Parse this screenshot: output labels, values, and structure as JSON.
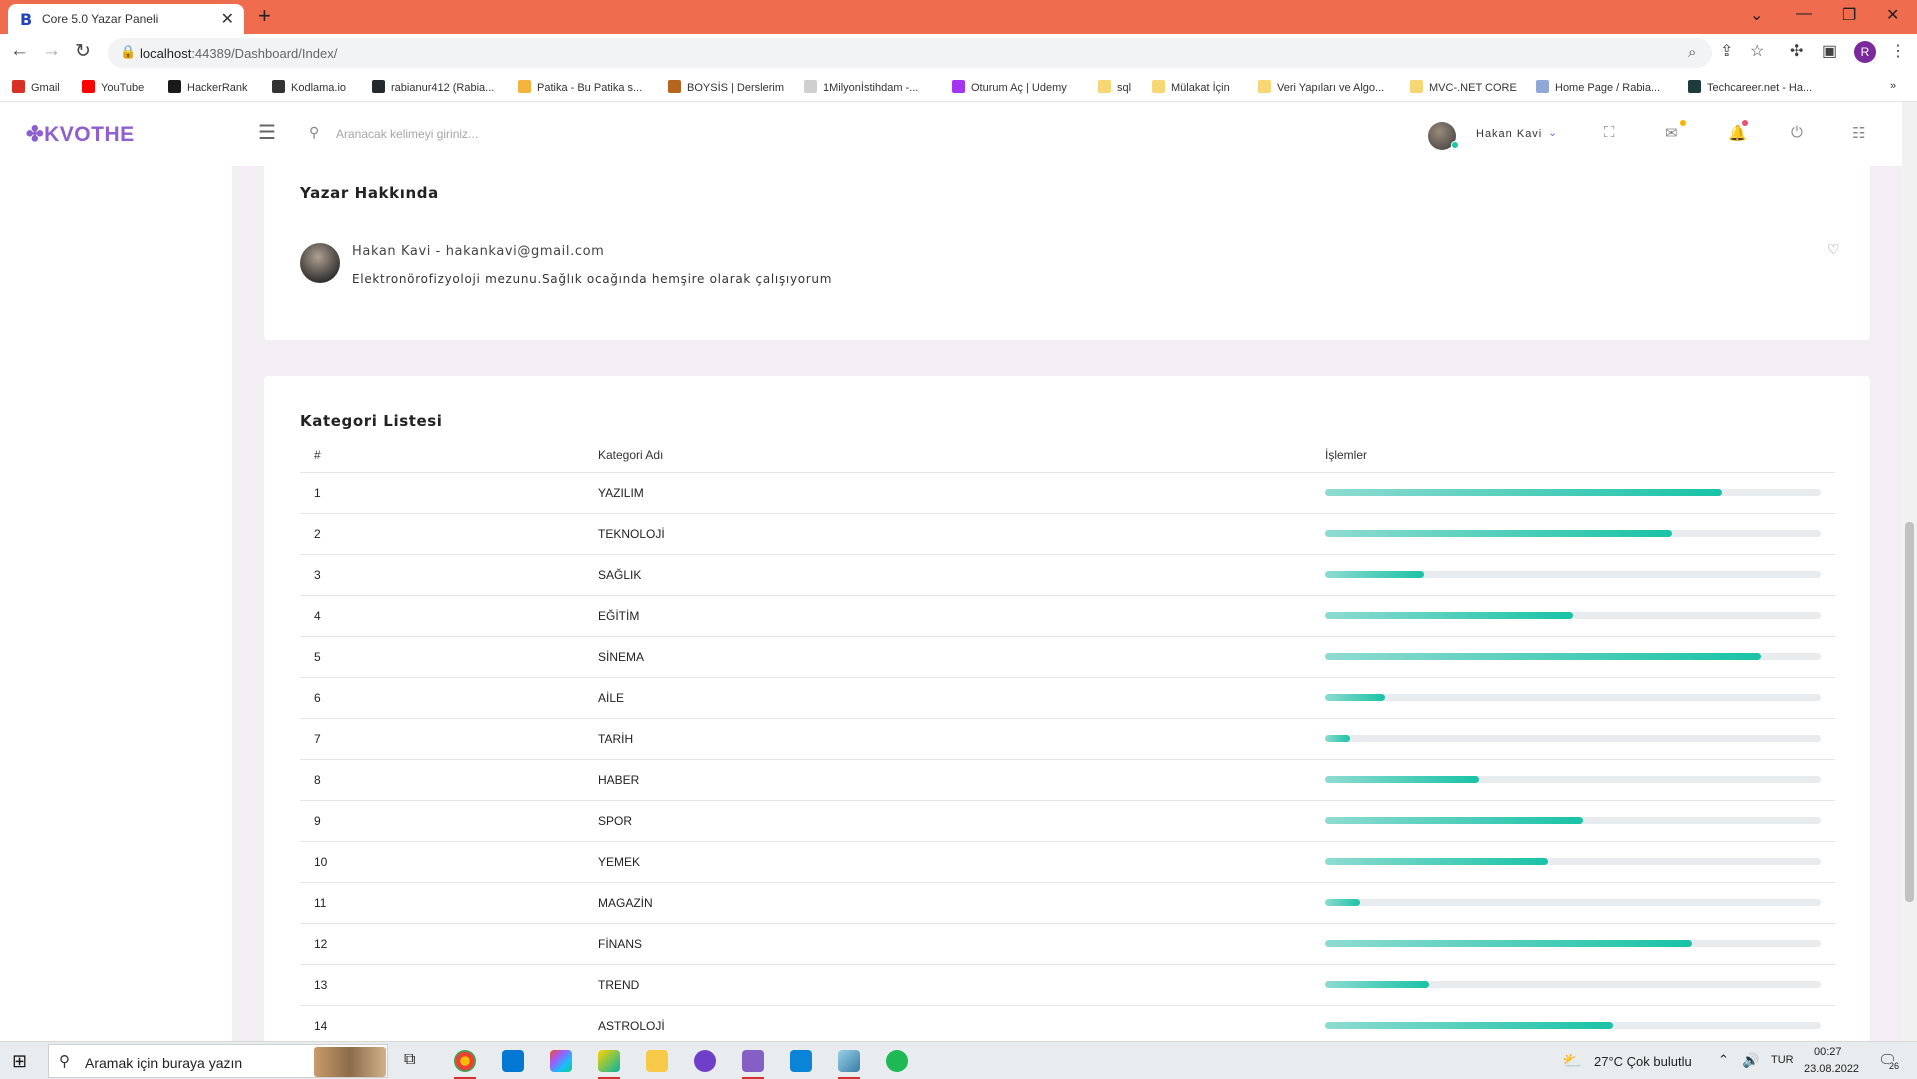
{
  "browser": {
    "tab_title": "Core 5.0 Yazar Paneli",
    "tab_favicon": "B",
    "url_host": "localhost",
    "url_rest": ":44389/Dashboard/Index/",
    "profile_initial": "R",
    "bookmarks": [
      {
        "label": "Gmail",
        "color": "#d93025"
      },
      {
        "label": "YouTube",
        "color": "#ff0000"
      },
      {
        "label": "HackerRank",
        "color": "#1a1a1a"
      },
      {
        "label": "Kodlama.io",
        "color": "#333333"
      },
      {
        "label": "rabianur412 (Rabia...",
        "color": "#24292e"
      },
      {
        "label": "Patika - Bu Patika s...",
        "color": "#f3b43e"
      },
      {
        "label": "BOYSİS | Derslerim",
        "color": "#b5651d"
      },
      {
        "label": "1Milyonİstihdam -...",
        "color": "#cfcfcf"
      },
      {
        "label": "Oturum Aç | Udemy",
        "color": "#a435f0"
      },
      {
        "label": "sql",
        "color": "#f7d774"
      },
      {
        "label": "Mülakat İçin",
        "color": "#f7d774"
      },
      {
        "label": "Veri Yapıları ve Algo...",
        "color": "#f7d774"
      },
      {
        "label": "MVC-.NET CORE",
        "color": "#f7d774"
      },
      {
        "label": "Home Page / Rabia...",
        "color": "#8fa8d8"
      },
      {
        "label": "Techcareer.net - Ha...",
        "color": "#1d3b3b"
      }
    ]
  },
  "topnav": {
    "logo": "KVOTHE",
    "search_placeholder": "Aranacak kelimeyi giriniz...",
    "username": "Hakan Kavi"
  },
  "about": {
    "title": "Yazar Hakkında",
    "name_email": "Hakan Kavi - hakankavi@gmail.com",
    "bio": "Elektronörofizyoloji mezunu.Sağlık ocağında hemşire olarak çalışıyorum"
  },
  "categories": {
    "title": "Kategori Listesi",
    "headers": [
      "#",
      "Kategori Adı",
      "İşlemler"
    ],
    "rows": [
      {
        "no": "1",
        "name": "YAZILIM",
        "progress": 80
      },
      {
        "no": "2",
        "name": "TEKNOLOJİ",
        "progress": 70
      },
      {
        "no": "3",
        "name": "SAĞLIK",
        "progress": 20
      },
      {
        "no": "4",
        "name": "EĞİTİM",
        "progress": 50
      },
      {
        "no": "5",
        "name": "SİNEMA",
        "progress": 88
      },
      {
        "no": "6",
        "name": "AİLE",
        "progress": 12
      },
      {
        "no": "7",
        "name": "TARİH",
        "progress": 5
      },
      {
        "no": "8",
        "name": "HABER",
        "progress": 31
      },
      {
        "no": "9",
        "name": "SPOR",
        "progress": 52
      },
      {
        "no": "10",
        "name": "YEMEK",
        "progress": 45
      },
      {
        "no": "11",
        "name": "MAGAZİN",
        "progress": 7
      },
      {
        "no": "12",
        "name": "FİNANS",
        "progress": 74
      },
      {
        "no": "13",
        "name": "TREND",
        "progress": 21
      },
      {
        "no": "14",
        "name": "ASTROLOJİ",
        "progress": 58
      }
    ]
  },
  "taskbar": {
    "search_text": "Aramak için buraya yazın",
    "weather": "27°C  Çok bulutlu",
    "lang": "TUR",
    "time": "00:27",
    "date": "23.08.2022",
    "notification_count": "26"
  }
}
